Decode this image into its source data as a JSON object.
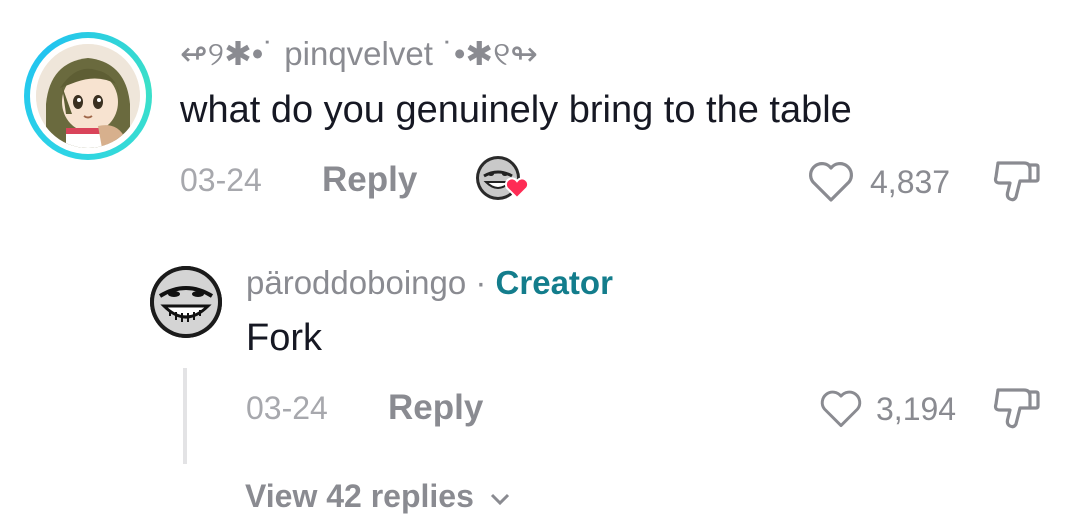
{
  "comments": [
    {
      "username": "pinqvelvet",
      "username_prefix": "↫୨✱•˙",
      "username_suffix": "˙•✱୧↬",
      "text": "what do you genuinely bring to the table",
      "date": "03-24",
      "reply_label": "Reply",
      "likes": "4,837"
    }
  ],
  "replies": [
    {
      "username": "päroddoboingo",
      "separator": " · ",
      "badge": "Creator",
      "text": "Fork",
      "date": "03-24",
      "reply_label": "Reply",
      "likes": "3,194"
    }
  ],
  "view_replies_label": "View 42 replies",
  "icons": {
    "like": "heart-outline-icon",
    "dislike": "thumbs-down-icon",
    "expand": "chevron-down-icon",
    "creator_liked": "heart-badge-icon"
  },
  "colors": {
    "accent_creator": "#137d8c",
    "heart_badge": "#fe2c55",
    "ring": "#2dd4e6"
  }
}
